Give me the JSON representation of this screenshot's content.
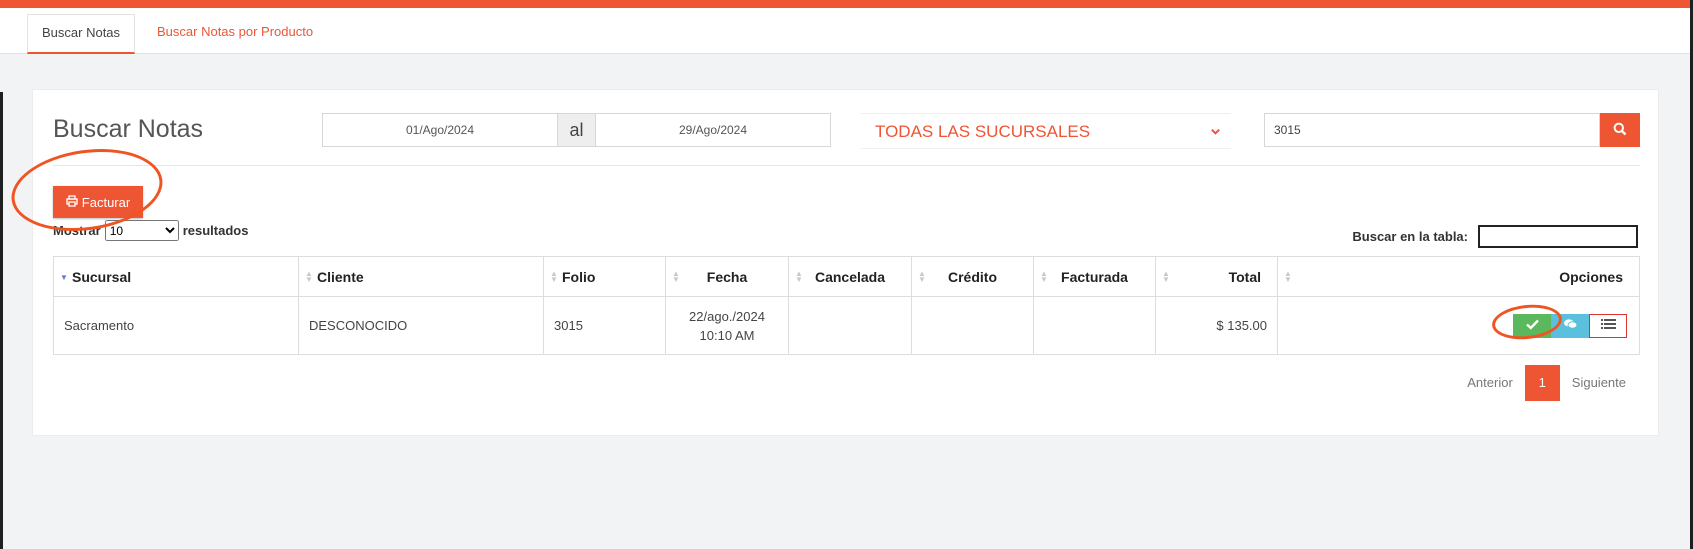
{
  "tabs": [
    {
      "label": "Buscar Notas"
    },
    {
      "label": "Buscar Notas por Producto"
    }
  ],
  "header": {
    "title": "Buscar Notas",
    "date_from": "01/Ago/2024",
    "date_sep": "al",
    "date_to": "29/Ago/2024",
    "branch": "TODAS LAS SUCURSALES",
    "search_value": "3015"
  },
  "toolbar": {
    "facturar_label": "Facturar",
    "show_prefix": "Mostrar",
    "show_value": "10",
    "show_suffix": "resultados",
    "table_search_label": "Buscar en la tabla:"
  },
  "table": {
    "columns": [
      "Sucursal",
      "Cliente",
      "Folio",
      "Fecha",
      "Cancelada",
      "Crédito",
      "Facturada",
      "Total",
      "Opciones"
    ],
    "rows": [
      {
        "sucursal": "Sacramento",
        "cliente": "DESCONOCIDO",
        "folio": "3015",
        "fecha_date": "22/ago./2024",
        "fecha_time": "10:10 AM",
        "cancelada": "",
        "credito": "",
        "facturada": "",
        "total": "$ 135.00"
      }
    ]
  },
  "pagination": {
    "prev": "Anterior",
    "current": "1",
    "next": "Siguiente"
  },
  "colors": {
    "accent": "#ee5533",
    "success": "#5cb85c",
    "info": "#5bc0de"
  },
  "icons": [
    "search-icon",
    "print-icon",
    "chevron-down-icon",
    "check-icon",
    "comments-icon",
    "list-icon",
    "sort-icon"
  ]
}
